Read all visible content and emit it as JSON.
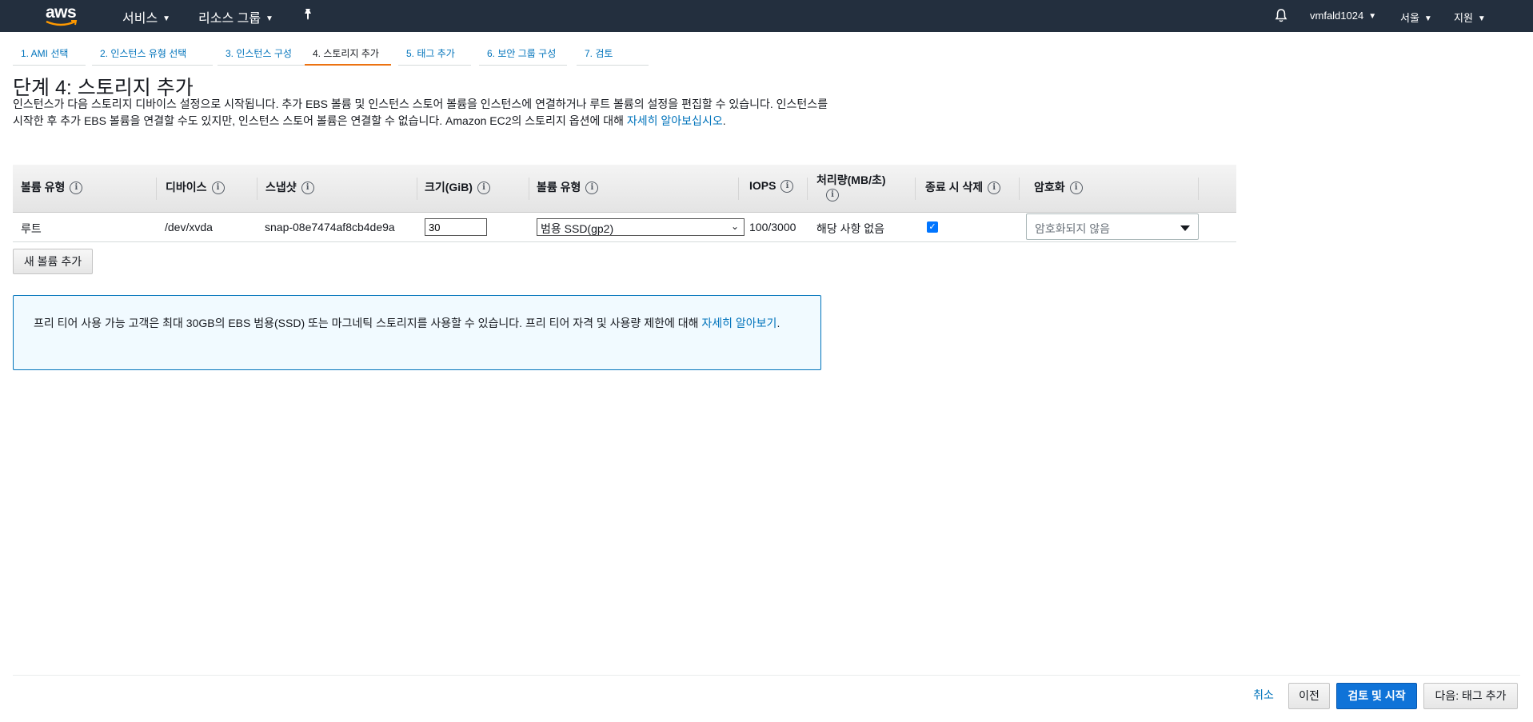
{
  "nav": {
    "logo_text": "aws",
    "services": "서비스",
    "resource_groups": "리소스 그룹",
    "user": "vmfald1024",
    "region": "서울",
    "support": "지원"
  },
  "tabs": [
    {
      "label": "1. AMI 선택"
    },
    {
      "label": "2. 인스턴스 유형 선택"
    },
    {
      "label": "3. 인스턴스 구성"
    },
    {
      "label": "4. 스토리지 추가"
    },
    {
      "label": "5. 태그 추가"
    },
    {
      "label": "6. 보안 그룹 구성"
    },
    {
      "label": "7. 검토"
    }
  ],
  "page": {
    "title": "단계 4: 스토리지 추가",
    "description": "인스턴스가 다음 스토리지 디바이스 설정으로 시작됩니다. 추가 EBS 볼륨 및 인스턴스 스토어 볼륨을 인스턴스에 연결하거나 루트 볼륨의 설정을 편집할 수 있습니다. 인스턴스를 시작한 후 추가 EBS 볼륨을 연결할 수도 있지만, 인스턴스 스토어 볼륨은 연결할 수 없습니다. Amazon EC2의 스토리지 옵션에 대해 ",
    "learn_more": "자세히 알아보십시오",
    "period": "."
  },
  "table": {
    "headers": {
      "volume_type": "볼륨 유형",
      "device": "디바이스",
      "snapshot": "스냅샷",
      "size": "크기(GiB)",
      "volume_kind": "볼륨 유형",
      "iops": "IOPS",
      "throughput": "처리량(MB/초)",
      "delete_on_term": "종료 시 삭제",
      "encryption": "암호화"
    },
    "info_glyph": "i",
    "row": {
      "volume_type": "루트",
      "device": "/dev/xvda",
      "snapshot": "snap-08e7474af8cb4de9a",
      "size": "30",
      "volume_kind": "범용 SSD(gp2)",
      "iops": "100/3000",
      "throughput": "해당 사항 없음",
      "delete_on_term": true,
      "encryption": "암호화되지 않음"
    }
  },
  "add_volume_button": "새 볼륨 추가",
  "info_box": {
    "text": "프리 티어 사용 가능 고객은 최대 30GB의 EBS 범용(SSD) 또는 마그네틱 스토리지를 사용할 수 있습니다. 프리 티어 자격 및 사용량 제한에 대해 ",
    "link": "자세히 알아보기",
    "period": "."
  },
  "footer": {
    "cancel": "취소",
    "previous": "이전",
    "review_launch": "검토 및 시작",
    "next": "다음: 태그 추가"
  },
  "colors": {
    "nav_bg": "#232f3e",
    "link": "#0073bb",
    "active_tab": "#ec7211",
    "primary": "#0f73d8",
    "info_bg": "#f1faff"
  }
}
